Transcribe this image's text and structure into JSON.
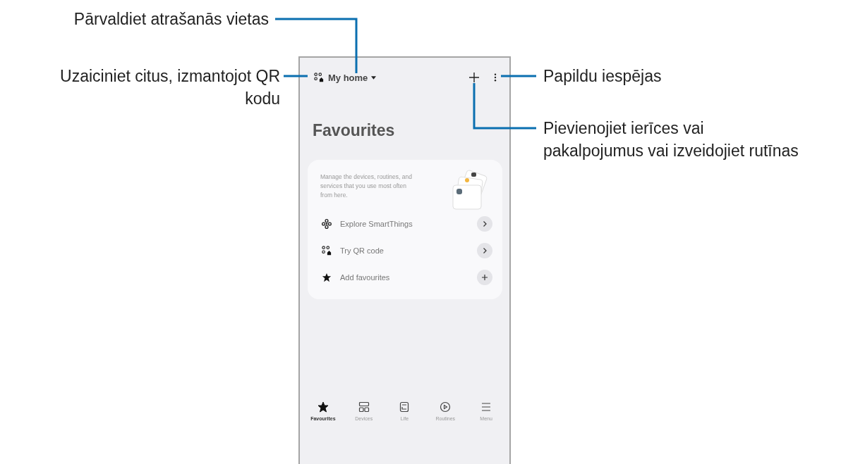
{
  "callouts": [
    {
      "kind": "top",
      "lines": [
        "Pārvaldiet atrašanās vietas"
      ]
    },
    {
      "kind": "left",
      "lines": [
        "Uzaiciniet citus, izmantojot QR",
        "kodu"
      ]
    },
    {
      "kind": "right",
      "lines": [
        "Papildu iespējas"
      ]
    },
    {
      "kind": "right-low",
      "lines": [
        "Pievienojiet ierīces vai",
        "pakalpojumus vai izveidojiet rutīnas"
      ]
    }
  ],
  "phone": {
    "location": "My home",
    "title": "Favourites",
    "card": {
      "description": "Manage the devices, routines, and services that you use most often from here.",
      "items": [
        {
          "kind": "explore",
          "label": "Explore SmartThings",
          "button": {
            "kind": "arrow"
          }
        },
        {
          "kind": "qr",
          "label": "Try QR code",
          "button": {
            "kind": "arrow"
          }
        },
        {
          "kind": "star",
          "label": "Add favourites",
          "button": {
            "kind": "add"
          }
        }
      ]
    },
    "nav": [
      {
        "kind": "favourites",
        "label": "Favourites",
        "selected": true
      },
      {
        "kind": "devices",
        "label": "Devices",
        "selected": false
      },
      {
        "kind": "life",
        "label": "Life",
        "selected": false
      },
      {
        "kind": "routines",
        "label": "Routines",
        "selected": false
      },
      {
        "kind": "menu",
        "label": "Menu",
        "selected": false
      }
    ]
  }
}
